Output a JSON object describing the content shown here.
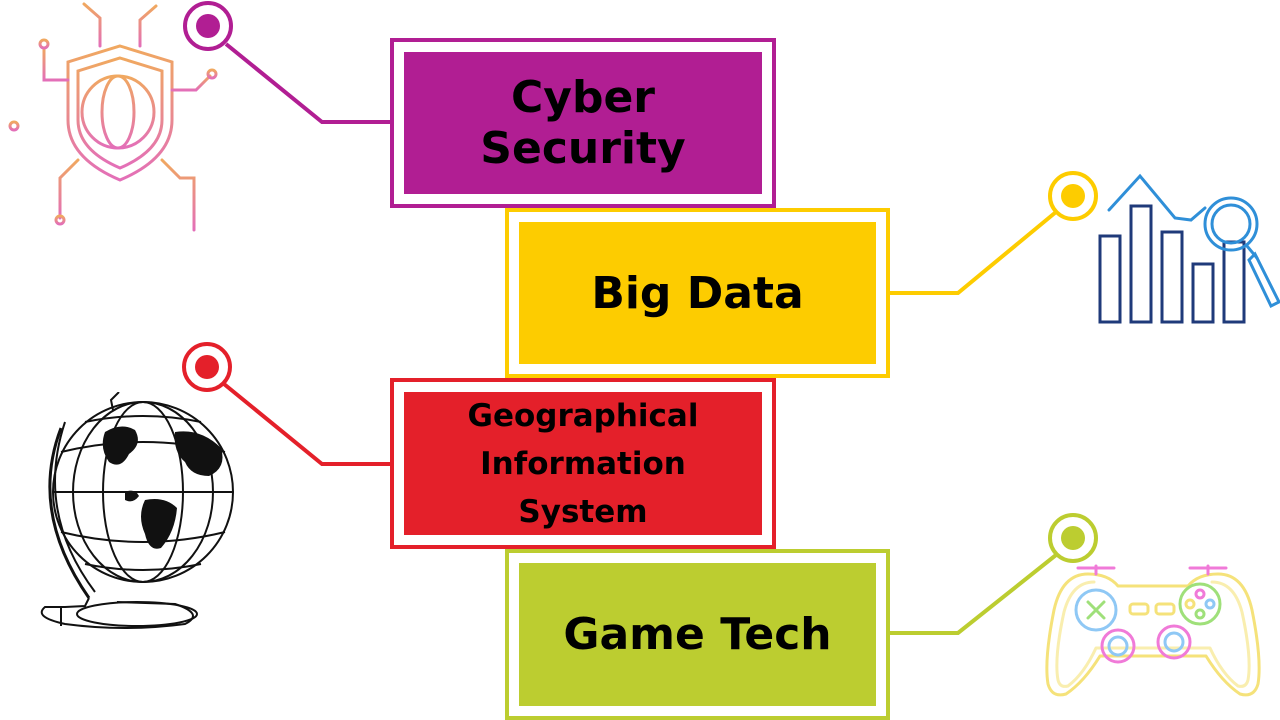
{
  "topics": [
    {
      "key": "cyber",
      "label_lines": [
        "Cyber Security"
      ],
      "color": "#b11e93",
      "icon": "shield-globe-circuit-icon"
    },
    {
      "key": "bigdata",
      "label_lines": [
        "Big Data"
      ],
      "color": "#fdcc00",
      "icon": "bar-chart-magnifier-icon"
    },
    {
      "key": "gis",
      "label_lines": [
        "Geographical",
        "Information",
        "System"
      ],
      "color": "#e4202a",
      "icon": "globe-icon"
    },
    {
      "key": "game",
      "label_lines": [
        "Game Tech"
      ],
      "color": "#bccd30",
      "icon": "gamepad-neon-icon"
    }
  ],
  "colors": {
    "icon_navy": "#1f3a7a",
    "icon_blue": "#2f8fd8",
    "icon_pink": "#e36fb8",
    "icon_orange": "#f0a860",
    "neon_yellow": "#f5e27a",
    "neon_pink": "#f07ad8",
    "neon_green": "#9fe07a",
    "neon_blue": "#8fc8f5"
  }
}
